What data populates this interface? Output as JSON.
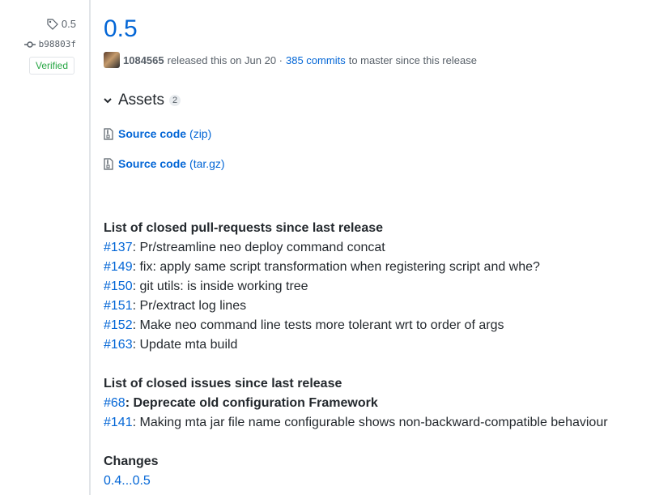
{
  "sidebar": {
    "tag": "0.5",
    "commit": "b98803f",
    "verified": "Verified"
  },
  "release": {
    "title": "0.5",
    "author": "1084565",
    "released_text": "released this on Jun 20 ·",
    "commits_link": "385 commits",
    "since_text": "to master since this release"
  },
  "assets": {
    "heading": "Assets",
    "count": "2",
    "items": [
      {
        "name": "Source code",
        "ext": "(zip)"
      },
      {
        "name": "Source code",
        "ext": "(tar.gz)"
      }
    ]
  },
  "notes": {
    "pr_heading": "List of closed pull-requests since last release",
    "prs": [
      {
        "num": "#137",
        "text": ": Pr/streamline neo deploy command concat"
      },
      {
        "num": "#149",
        "text": ": fix: apply same script transformation when registering script and whe?"
      },
      {
        "num": "#150",
        "text": ": git utils: is inside working tree"
      },
      {
        "num": "#151",
        "text": ": Pr/extract log lines"
      },
      {
        "num": "#152",
        "text": ": Make neo command line tests more tolerant wrt to order of args"
      },
      {
        "num": "#163",
        "text": ": Update mta build"
      }
    ],
    "issues_heading": "List of closed issues since last release",
    "issues": [
      {
        "num": "#68",
        "text": ": Deprecate old configuration Framework"
      },
      {
        "num": "#141",
        "text": ": Making mta jar file name configurable shows non-backward-compatible behaviour"
      }
    ],
    "changes_heading": "Changes",
    "changes_link": "0.4...0.5"
  },
  "colors": {
    "link": "#0366d6",
    "verified": "#28a745",
    "text": "#24292e",
    "muted": "#586069"
  }
}
